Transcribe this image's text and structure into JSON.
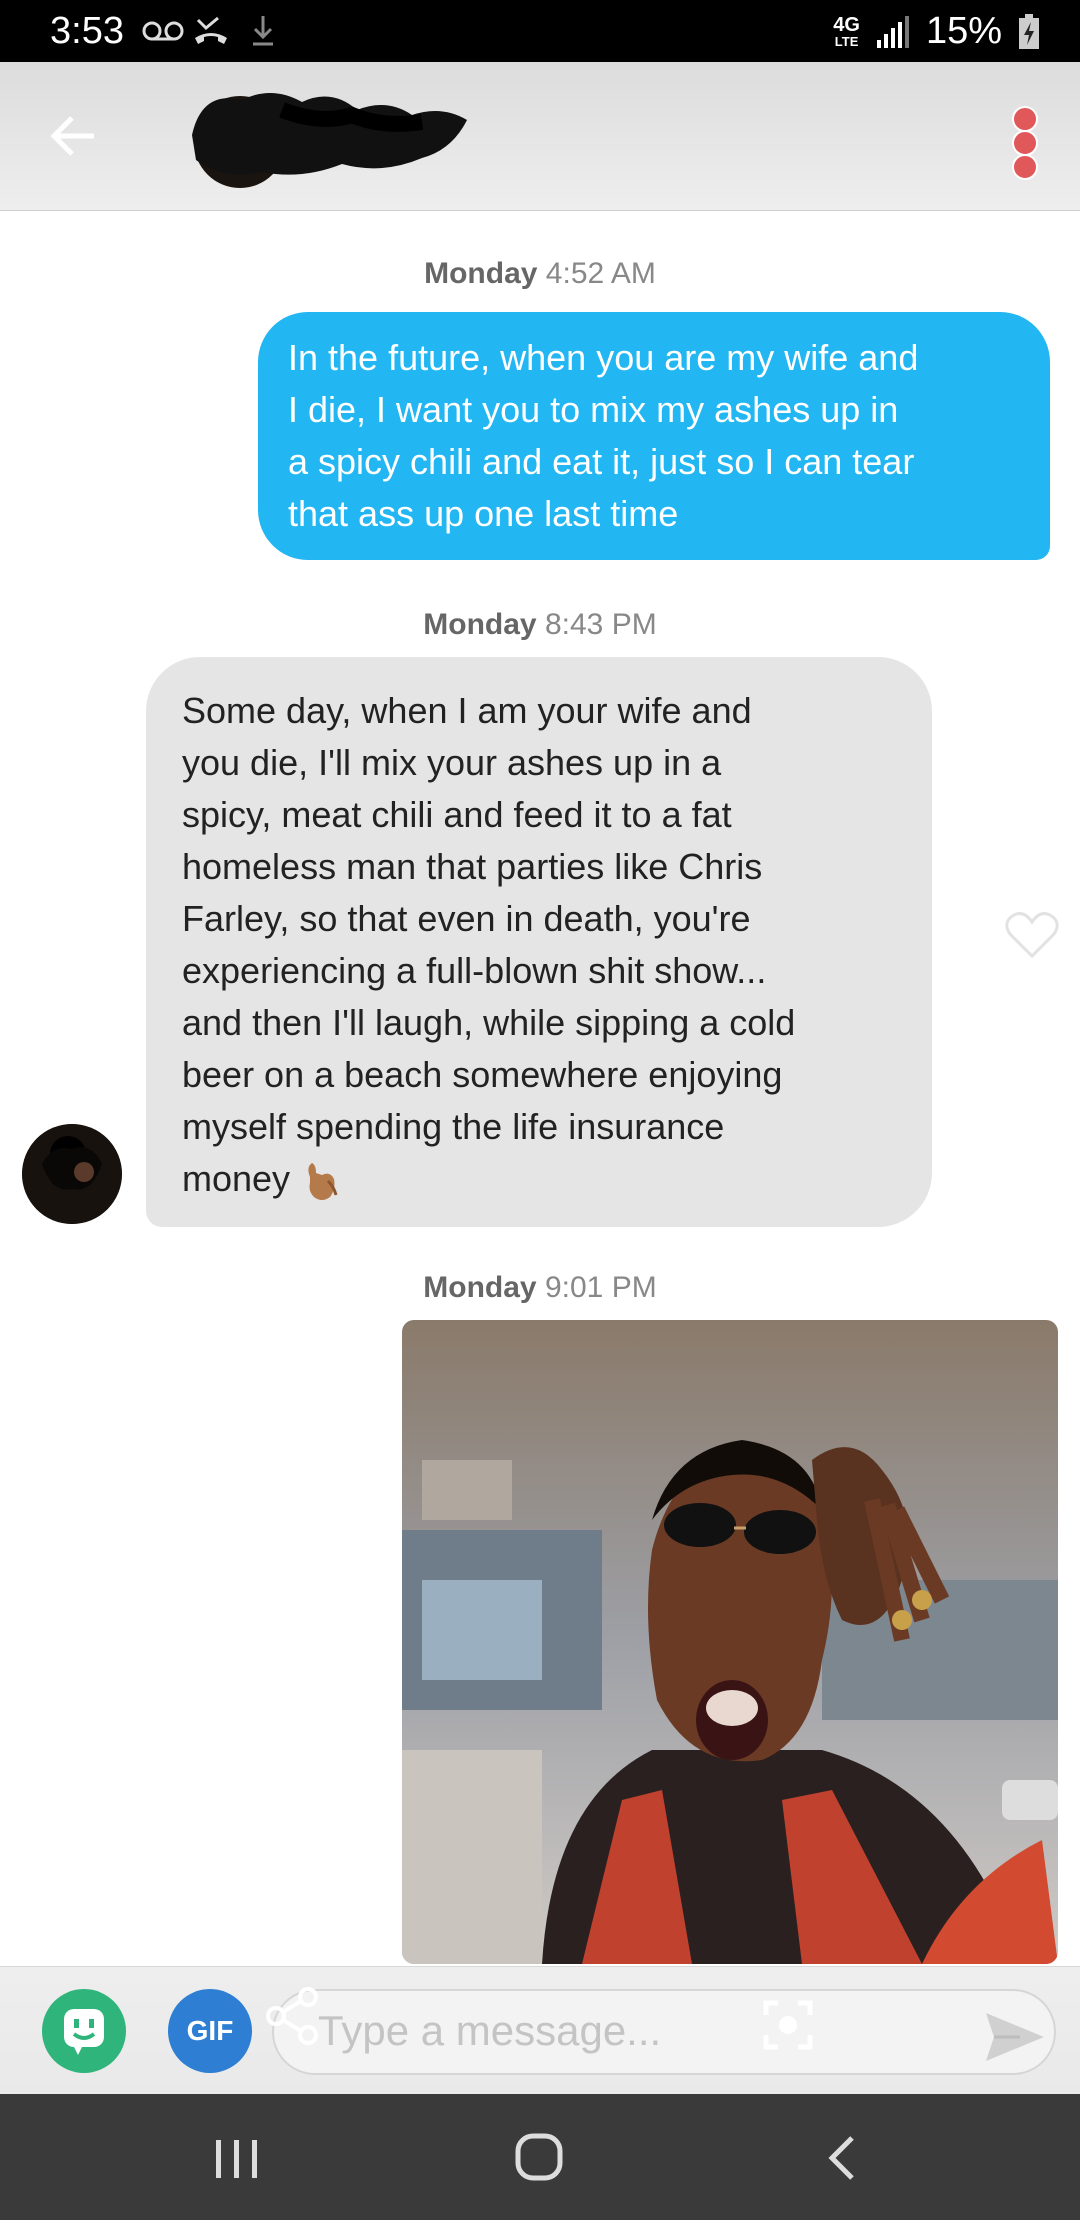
{
  "status_bar": {
    "time": "3:53",
    "icons": [
      "voicemail-icon",
      "missed-call-icon",
      "download-icon"
    ],
    "network_top": "4G",
    "network_bottom": "LTE",
    "signal_icon": "signal-bars-icon",
    "battery": "15%",
    "battery_icon": "battery-charging-icon"
  },
  "header": {
    "back_icon": "arrow-left-icon",
    "menu_icon": "more-vertical-icon",
    "menu_color": "#e0585a"
  },
  "conversation": {
    "messages": [
      {
        "timestamp_day": "Monday",
        "timestamp_time": "4:52 AM",
        "direction": "sent",
        "lines": [
          "In the future, when you are my wife and",
          "I die, I want you to mix my ashes up in",
          "a spicy chili and eat it, just so I can tear",
          "that ass up one last time"
        ]
      },
      {
        "timestamp_day": "Monday",
        "timestamp_time": "8:43 PM",
        "direction": "received",
        "lines": [
          "Some day, when I am your wife and",
          "you die, I'll mix your ashes up in a",
          "spicy, meat chili and feed it to a fat",
          "homeless man that parties like Chris",
          "Farley, so that even in death, you're",
          "experiencing a full-blown shit show...",
          "and then I'll laugh, while sipping a cold",
          "beer on a beach somewhere enjoying",
          "myself spending the life insurance",
          "money"
        ],
        "emoji": "call-me-hand-emoji"
      },
      {
        "timestamp_day": "Monday",
        "timestamp_time": "9:01 PM",
        "direction": "sent",
        "type": "gif"
      }
    ],
    "sent_bubble_color": "#22b6f2",
    "received_bubble_color": "#e5e5e5"
  },
  "composer": {
    "bitmoji_icon": "bitmoji-icon",
    "gif_label": "GIF",
    "share_icon": "share-icon",
    "placeholder": "Type a message...",
    "scan_icon": "scan-icon",
    "send_icon": "send-icon"
  },
  "nav_bar": {
    "recents_icon": "recents-icon",
    "home_icon": "home-icon",
    "back_icon": "chevron-left-icon"
  }
}
